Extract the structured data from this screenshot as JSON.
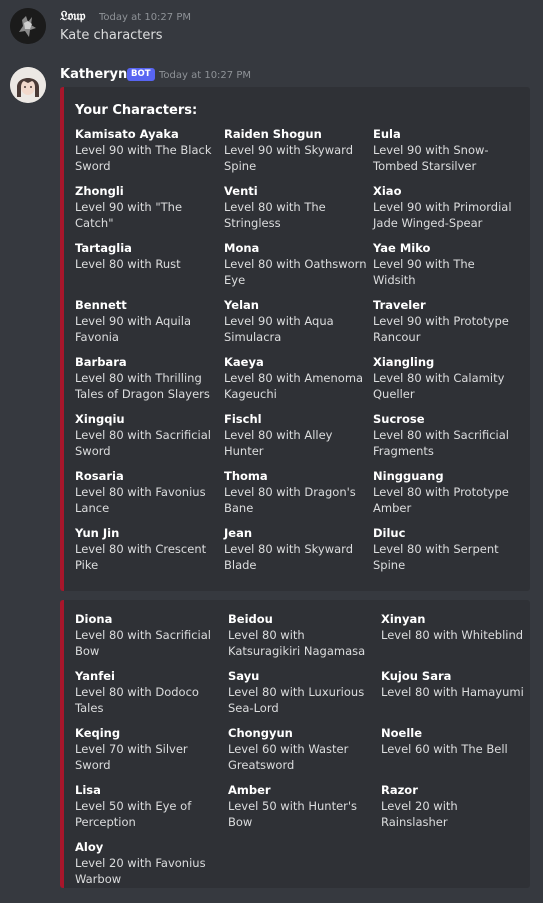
{
  "message1": {
    "username": "𝔏𝔬𝔲𝔭",
    "timestamp": "Today at 10:27 PM",
    "text": "Kate characters"
  },
  "message2": {
    "username": "Katheryne",
    "badge": "BOT",
    "timestamp": "Today at 10:27 PM"
  },
  "embed1": {
    "title": "Your Characters:",
    "accent_color": "#a8162b",
    "fields": [
      {
        "name": "Kamisato Ayaka",
        "value": "Level 90 with The Black Sword"
      },
      {
        "name": "Raiden Shogun",
        "value": "Level 90 with Skyward Spine"
      },
      {
        "name": "Eula",
        "value": "Level 90 with Snow-Tombed Starsilver"
      },
      {
        "name": "Zhongli",
        "value": "Level 90 with \"The Catch\""
      },
      {
        "name": "Venti",
        "value": "Level 80 with The Stringless"
      },
      {
        "name": "Xiao",
        "value": "Level 90 with Primordial Jade Winged-Spear"
      },
      {
        "name": "Tartaglia",
        "value": "Level 80 with Rust"
      },
      {
        "name": "Mona",
        "value": "Level 80 with Oathsworn Eye"
      },
      {
        "name": "Yae Miko",
        "value": "Level 90 with The Widsith"
      },
      {
        "name": "Bennett",
        "value": "Level 90 with Aquila Favonia"
      },
      {
        "name": "Yelan",
        "value": "Level 90 with Aqua Simulacra"
      },
      {
        "name": "Traveler",
        "value": "Level 90 with Prototype Rancour"
      },
      {
        "name": "Barbara",
        "value": "Level 80 with Thrilling Tales of Dragon Slayers"
      },
      {
        "name": "Kaeya",
        "value": "Level 80 with Amenoma Kageuchi"
      },
      {
        "name": "Xiangling",
        "value": "Level 80 with Calamity Queller"
      },
      {
        "name": "Xingqiu",
        "value": "Level 80 with Sacrificial Sword"
      },
      {
        "name": "Fischl",
        "value": "Level 80 with Alley Hunter"
      },
      {
        "name": "Sucrose",
        "value": "Level 80 with Sacrificial Fragments"
      },
      {
        "name": "Rosaria",
        "value": "Level 80 with Favonius Lance"
      },
      {
        "name": "Thoma",
        "value": "Level 80 with Dragon's Bane"
      },
      {
        "name": "Ningguang",
        "value": "Level 80 with Prototype Amber"
      },
      {
        "name": "Yun Jin",
        "value": "Level 80 with Crescent Pike"
      },
      {
        "name": "Jean",
        "value": "Level 80 with Skyward Blade"
      },
      {
        "name": "Diluc",
        "value": "Level 80 with Serpent Spine"
      }
    ]
  },
  "embed2": {
    "accent_color": "#a8162b",
    "fields": [
      {
        "name": "Diona",
        "value": "Level 80 with Sacrificial Bow"
      },
      {
        "name": "Beidou",
        "value": "Level 80 with Katsuragikiri Nagamasa"
      },
      {
        "name": "Xinyan",
        "value": "Level 80 with Whiteblind"
      },
      {
        "name": "Yanfei",
        "value": "Level 80 with Dodoco Tales"
      },
      {
        "name": "Sayu",
        "value": "Level 80 with Luxurious Sea-Lord"
      },
      {
        "name": "Kujou Sara",
        "value": "Level 80 with Hamayumi"
      },
      {
        "name": "Keqing",
        "value": "Level 70 with Silver Sword"
      },
      {
        "name": "Chongyun",
        "value": "Level 60 with Waster Greatsword"
      },
      {
        "name": "Noelle",
        "value": "Level 60 with The Bell"
      },
      {
        "name": "Lisa",
        "value": "Level 50 with Eye of Perception"
      },
      {
        "name": "Amber",
        "value": "Level 50 with Hunter's Bow"
      },
      {
        "name": "Razor",
        "value": "Level 20 with Rainslasher"
      },
      {
        "name": "Aloy",
        "value": "Level 20 with Favonius Warbow"
      }
    ]
  }
}
